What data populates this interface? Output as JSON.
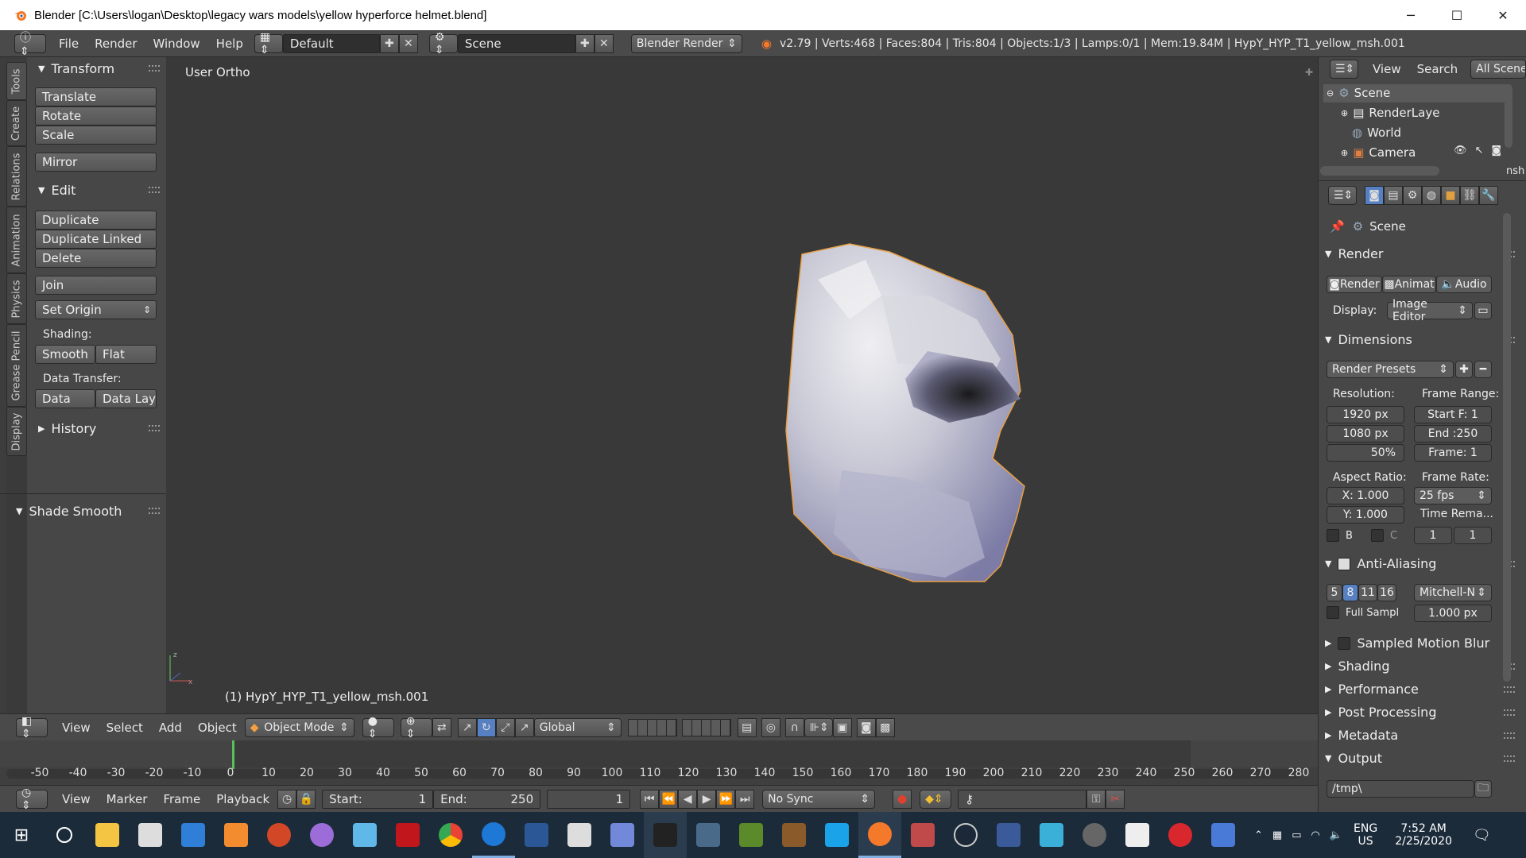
{
  "titlebar": {
    "title": "Blender [C:\\Users\\logan\\Desktop\\legacy wars models\\yellow hyperforce helmet.blend]",
    "minimize": "─",
    "maximize": "☐",
    "close": "✕"
  },
  "infobar": {
    "menus": [
      "File",
      "Render",
      "Window",
      "Help"
    ],
    "layout": "Default",
    "scene": "Scene",
    "engine": "Blender Render",
    "stats": "v2.79 | Verts:468 | Faces:804 | Tris:804 | Objects:1/3 | Lamps:0/1 | Mem:19.84M | HypY_HYP_T1_yellow_msh.001"
  },
  "tabs": [
    "Tools",
    "Create",
    "Relations",
    "Animation",
    "Physics",
    "Grease Pencil",
    "Display"
  ],
  "toolshelf": {
    "transform_title": "Transform",
    "translate": "Translate",
    "rotate": "Rotate",
    "scale": "Scale",
    "mirror": "Mirror",
    "edit_title": "Edit",
    "duplicate": "Duplicate",
    "duplicate_linked": "Duplicate Linked",
    "delete": "Delete",
    "join": "Join",
    "set_origin": "Set Origin",
    "shading_label": "Shading:",
    "smooth": "Smooth",
    "flat": "Flat",
    "data_transfer_label": "Data Transfer:",
    "data": "Data",
    "data_lay": "Data Lay",
    "history": "History",
    "shade_smooth": "Shade Smooth"
  },
  "viewport": {
    "view_label": "User Ortho",
    "object_label": "(1) HypY_HYP_T1_yellow_msh.001"
  },
  "vheader": {
    "menus": [
      "View",
      "Select",
      "Add",
      "Object"
    ],
    "mode": "Object Mode",
    "orientation": "Global"
  },
  "timeline": {
    "ticks": [
      "-50",
      "-40",
      "-30",
      "-20",
      "-10",
      "0",
      "10",
      "20",
      "30",
      "40",
      "50",
      "60",
      "70",
      "80",
      "90",
      "100",
      "110",
      "120",
      "130",
      "140",
      "150",
      "160",
      "170",
      "180",
      "190",
      "200",
      "210",
      "220",
      "230",
      "240",
      "250",
      "260",
      "270",
      "280"
    ]
  },
  "tlheader": {
    "menus": [
      "View",
      "Marker",
      "Frame",
      "Playback"
    ],
    "start_label": "Start:",
    "start": "1",
    "end_label": "End:",
    "end": "250",
    "current": "1",
    "sync": "No Sync"
  },
  "outliner": {
    "menus": [
      "View",
      "Search"
    ],
    "filter": "All Scenes",
    "items": [
      "Scene",
      "RenderLaye",
      "World",
      "Camera"
    ],
    "scroll_text": "nsh"
  },
  "props": {
    "scene": "Scene",
    "render_title": "Render",
    "render_btn": "Render",
    "anim_btn": "Animat",
    "audio_btn": "Audio",
    "display_label": "Display:",
    "display_value": "Image Editor",
    "dimensions_title": "Dimensions",
    "presets": "Render Presets",
    "resolution_label": "Resolution:",
    "res_x": "1920 px",
    "res_y": "1080 px",
    "res_pct": "50%",
    "frame_range_label": "Frame Range:",
    "start_f": "Start F: 1",
    "end_f": "End :250",
    "frame": "Frame: 1",
    "aspect_label": "Aspect Ratio:",
    "aspect_x": "X:  1.000",
    "aspect_y": "Y:  1.000",
    "frame_rate_label": "Frame Rate:",
    "fps": "25 fps",
    "time_rema": "Time Rema...",
    "b": "B",
    "c": "C",
    "t1": "1",
    "t2": "1",
    "aa_title": "Anti-Aliasing",
    "aa_samples": [
      "5",
      "8",
      "11",
      "16"
    ],
    "aa_filter": "Mitchell-N",
    "full_sampl": "Full Sampl",
    "filter_size": "1.000 px",
    "sampled_motion": "Sampled Motion Blur",
    "shading": "Shading",
    "performance": "Performance",
    "post_processing": "Post Processing",
    "metadata": "Metadata",
    "output_title": "Output",
    "output_path": "/tmp\\"
  },
  "taskbar": {
    "lang1": "ENG",
    "lang2": "US",
    "time": "7:52 AM",
    "date": "2/25/2020"
  }
}
